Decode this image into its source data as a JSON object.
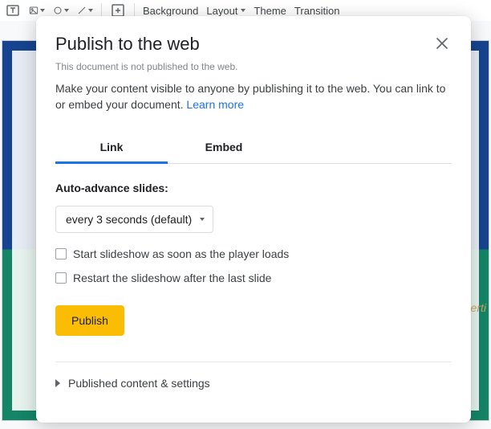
{
  "toolbar": {
    "items": [
      "Background",
      "Layout",
      "Theme",
      "Transition"
    ]
  },
  "slide": {
    "partial_text": "erti"
  },
  "dialog": {
    "title": "Publish to the web",
    "status": "This document is not published to the web.",
    "description": "Make your content visible to anyone by publishing it to the web. You can link to or embed your document. ",
    "learn_more": "Learn more",
    "tabs": {
      "link": "Link",
      "embed": "Embed"
    },
    "auto_advance_label": "Auto-advance slides:",
    "auto_advance_value": "every 3 seconds (default)",
    "checkbox_start": "Start slideshow as soon as the player loads",
    "checkbox_restart": "Restart the slideshow after the last slide",
    "publish_button": "Publish",
    "expand_section": "Published content & settings"
  }
}
